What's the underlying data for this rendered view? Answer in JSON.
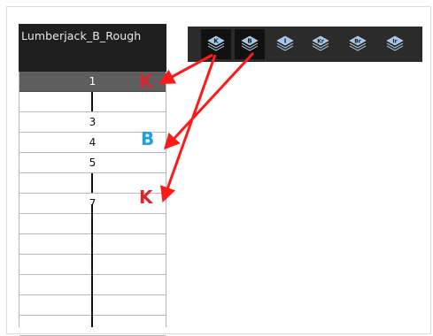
{
  "column": {
    "name": "Lumberjack_B_Rough"
  },
  "rows": [
    {
      "label": "1",
      "selected": true
    },
    {
      "label": "",
      "selected": false
    },
    {
      "label": "3",
      "selected": false
    },
    {
      "label": "4",
      "selected": false
    },
    {
      "label": "5",
      "selected": false
    },
    {
      "label": "",
      "selected": false
    },
    {
      "label": "7",
      "selected": false
    },
    {
      "label": "",
      "selected": false
    },
    {
      "label": "",
      "selected": false
    },
    {
      "label": "",
      "selected": false
    },
    {
      "label": "",
      "selected": false
    },
    {
      "label": "",
      "selected": false
    },
    {
      "label": "",
      "selected": false
    }
  ],
  "keyframe_markers": [
    {
      "text": "K",
      "color": "#d9262c"
    },
    {
      "text": "B",
      "color": "#1f9fe0"
    },
    {
      "text": "K",
      "color": "#d9262c"
    }
  ],
  "toolbar": {
    "buttons": [
      {
        "icon": "key-drawing-icon",
        "glyph": "K"
      },
      {
        "icon": "breakdown-drawing-icon",
        "glyph": "B"
      },
      {
        "icon": "in-between-drawing-icon",
        "glyph": "I"
      },
      {
        "icon": "retake-key-drawing-icon",
        "glyph": "Kr"
      },
      {
        "icon": "retake-breakdown-drawing-icon",
        "glyph": "Br"
      },
      {
        "icon": "retake-in-between-drawing-icon",
        "glyph": "Ir"
      }
    ]
  },
  "colors": {
    "arrow": "#ff1a1a",
    "key": "#d9262c",
    "breakdown": "#1f9fe0"
  }
}
